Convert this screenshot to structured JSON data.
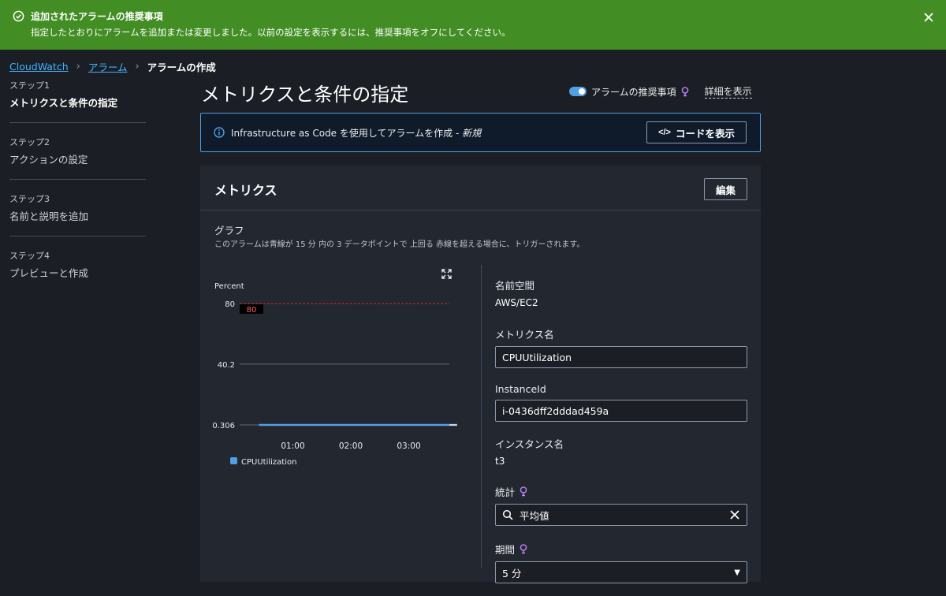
{
  "flash": {
    "title": "追加されたアラームの推奨事項",
    "message": "指定したとおりにアラームを追加または変更しました。以前の設定を表示するには、推奨事項をオフにしてください。"
  },
  "breadcrumb": {
    "items": [
      "CloudWatch",
      "アラーム"
    ],
    "current": "アラームの作成"
  },
  "steps": [
    {
      "num": "ステップ1",
      "label": "メトリクスと条件の指定"
    },
    {
      "num": "ステップ2",
      "label": "アクションの設定"
    },
    {
      "num": "ステップ3",
      "label": "名前と説明を追加"
    },
    {
      "num": "ステップ4",
      "label": "プレビューと作成"
    }
  ],
  "page_title": "メトリクスと条件の指定",
  "header": {
    "toggle_label": "アラームの推奨事項",
    "toggle_on": true,
    "detail_link": "詳細を表示"
  },
  "info": {
    "text": "Infrastructure as Code を使用してアラームを作成 - ",
    "tag": "新規",
    "button": "コードを表示"
  },
  "metrics_panel": {
    "title": "メトリクス",
    "edit_button": "編集",
    "graph_title": "グラフ",
    "graph_desc": "このアラームは青線が 15 分 内の 3 データポイントで 上回る 赤線を超える場合に、トリガーされます。"
  },
  "fields": {
    "namespace_label": "名前空間",
    "namespace_value": "AWS/EC2",
    "metric_label": "メトリクス名",
    "metric_value": "CPUUtilization",
    "instance_label": "InstanceId",
    "instance_value": "i-0436dff2dddad459a",
    "instance_name_label": "インスタンス名",
    "instance_name_value": "t3",
    "stat_label": "統計",
    "stat_value": "平均値",
    "period_label": "期間",
    "period_value": "5 分"
  },
  "colors": {
    "flash_bg": "#428e24",
    "link": "#42b4ff",
    "series": "#539fe5",
    "threshold": "#d13212",
    "info_border": "#539fe5"
  },
  "chart_data": {
    "type": "line",
    "ylabel": "Percent",
    "yticks": [
      "80",
      "40.2",
      "0.306"
    ],
    "ylim": [
      0.306,
      80
    ],
    "xticks": [
      "01:00",
      "02:00",
      "03:00"
    ],
    "threshold": {
      "value": 80,
      "label": "80"
    },
    "series": [
      {
        "name": "CPUUtilization",
        "x": [
          "00:25",
          "03:50"
        ],
        "values": [
          0.306,
          0.306
        ]
      }
    ]
  }
}
